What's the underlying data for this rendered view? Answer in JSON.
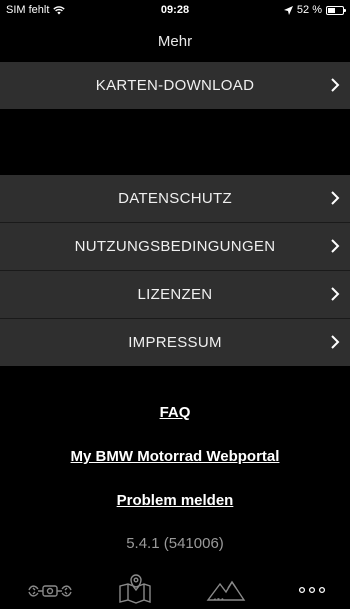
{
  "status_bar": {
    "carrier": "SIM fehlt",
    "time": "09:28",
    "battery": "52 %",
    "battery_level": 0.52
  },
  "nav": {
    "title": "Mehr"
  },
  "menu": {
    "karten_download": "KARTEN-DOWNLOAD",
    "datenschutz": "DATENSCHUTZ",
    "nutzungsbedingungen": "NUTZUNGSBEDINGUNGEN",
    "lizenzen": "LIZENZEN",
    "impressum": "IMPRESSUM"
  },
  "links": {
    "faq": "FAQ",
    "webportal": "My BMW Motorrad Webportal",
    "problem": "Problem melden"
  },
  "version": "5.4.1 (541006)",
  "tabs": [
    "motorcycle-icon",
    "map-icon",
    "mountains-icon",
    "more-icon"
  ],
  "colors": {
    "row_bg": "#2f2f2f",
    "background": "#000000",
    "tab_inactive": "#8a8a8a",
    "tab_active": "#ffffff"
  }
}
